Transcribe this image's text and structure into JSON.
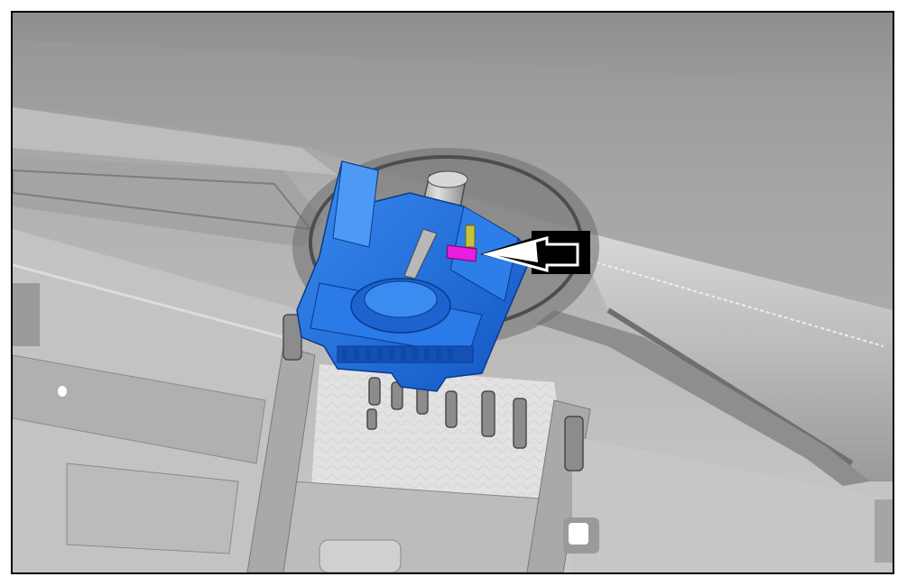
{
  "illustration": {
    "callout_arrow": "callout-arrow-icon"
  },
  "colors": {
    "highlight_part": "#1e6fe0",
    "highlight_dark": "#0f4fb8",
    "connector": "#e81ee0",
    "pin": "#c8c23a",
    "background": "#a8a8a8",
    "arrow": "#000000"
  }
}
